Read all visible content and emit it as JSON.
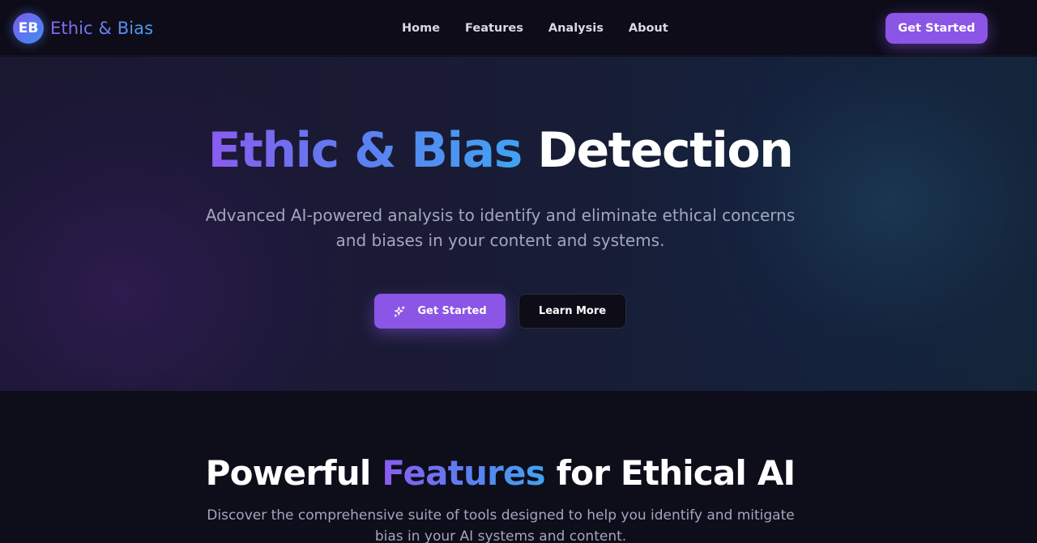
{
  "colors": {
    "background": "#0e0d1a",
    "navbar": "#0d0c18",
    "accent_purple": "#8b55e6",
    "gradient_start": "#8a5cf0",
    "gradient_end": "#3fa4f2",
    "muted_text": "#a3a6bd"
  },
  "brand": {
    "badge": "EB",
    "name": "Ethic & Bias"
  },
  "nav": {
    "links": [
      "Home",
      "Features",
      "Analysis",
      "About"
    ],
    "cta": "Get Started"
  },
  "hero": {
    "title_gradient": "Ethic & Bias",
    "title_plain": "Detection",
    "subtitle": "Advanced AI-powered analysis to identify and eliminate ethical concerns and biases in your content and systems.",
    "primary_button": "Get Started",
    "primary_button_icon": "sparkle-icon",
    "secondary_button": "Learn More"
  },
  "features": {
    "title_before": "Powerful",
    "title_gradient": "Features",
    "title_after": "for Ethical AI",
    "subtitle": "Discover the comprehensive suite of tools designed to help you identify and mitigate bias in your AI systems and content."
  }
}
